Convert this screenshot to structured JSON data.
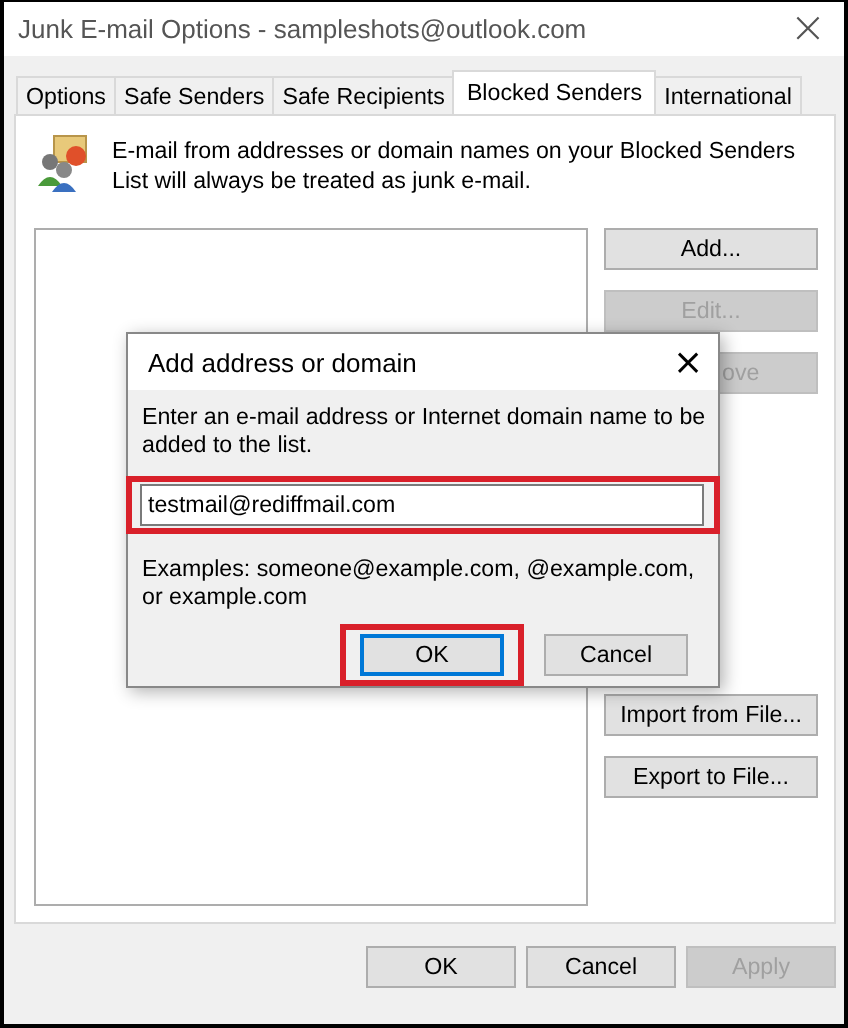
{
  "window": {
    "title": "Junk E-mail Options - sampleshots@outlook.com",
    "close": "×"
  },
  "tabs": [
    {
      "label": "Options",
      "selected": false
    },
    {
      "label": "Safe Senders",
      "selected": false
    },
    {
      "label": "Safe Recipients",
      "selected": false
    },
    {
      "label": "Blocked Senders",
      "selected": true
    },
    {
      "label": "International",
      "selected": false
    }
  ],
  "description": "E-mail from addresses or domain names on your Blocked Senders List will always be treated as junk e-mail.",
  "side_buttons": [
    {
      "label": "Add...",
      "disabled": false
    },
    {
      "label": "Edit...",
      "disabled": true
    },
    {
      "label": "ove",
      "disabled": true
    },
    {
      "label": "Import from File...",
      "disabled": false
    },
    {
      "label": "Export to File...",
      "disabled": false
    }
  ],
  "dialog": {
    "title": "Add address or domain",
    "close": "×",
    "prompt": "Enter an e-mail address or Internet domain name to be added to the list.",
    "input": {
      "value": "testmail@rediffmail.com",
      "highlighted": true
    },
    "examples": "Examples: someone@example.com, @example.com, or example.com",
    "buttons": [
      {
        "label": "OK",
        "default": true,
        "highlighted": true
      },
      {
        "label": "Cancel",
        "default": false,
        "highlighted": false
      }
    ]
  },
  "footer_buttons": [
    {
      "label": "OK",
      "disabled": false
    },
    {
      "label": "Cancel",
      "disabled": false
    },
    {
      "label": "Apply",
      "disabled": true
    }
  ]
}
